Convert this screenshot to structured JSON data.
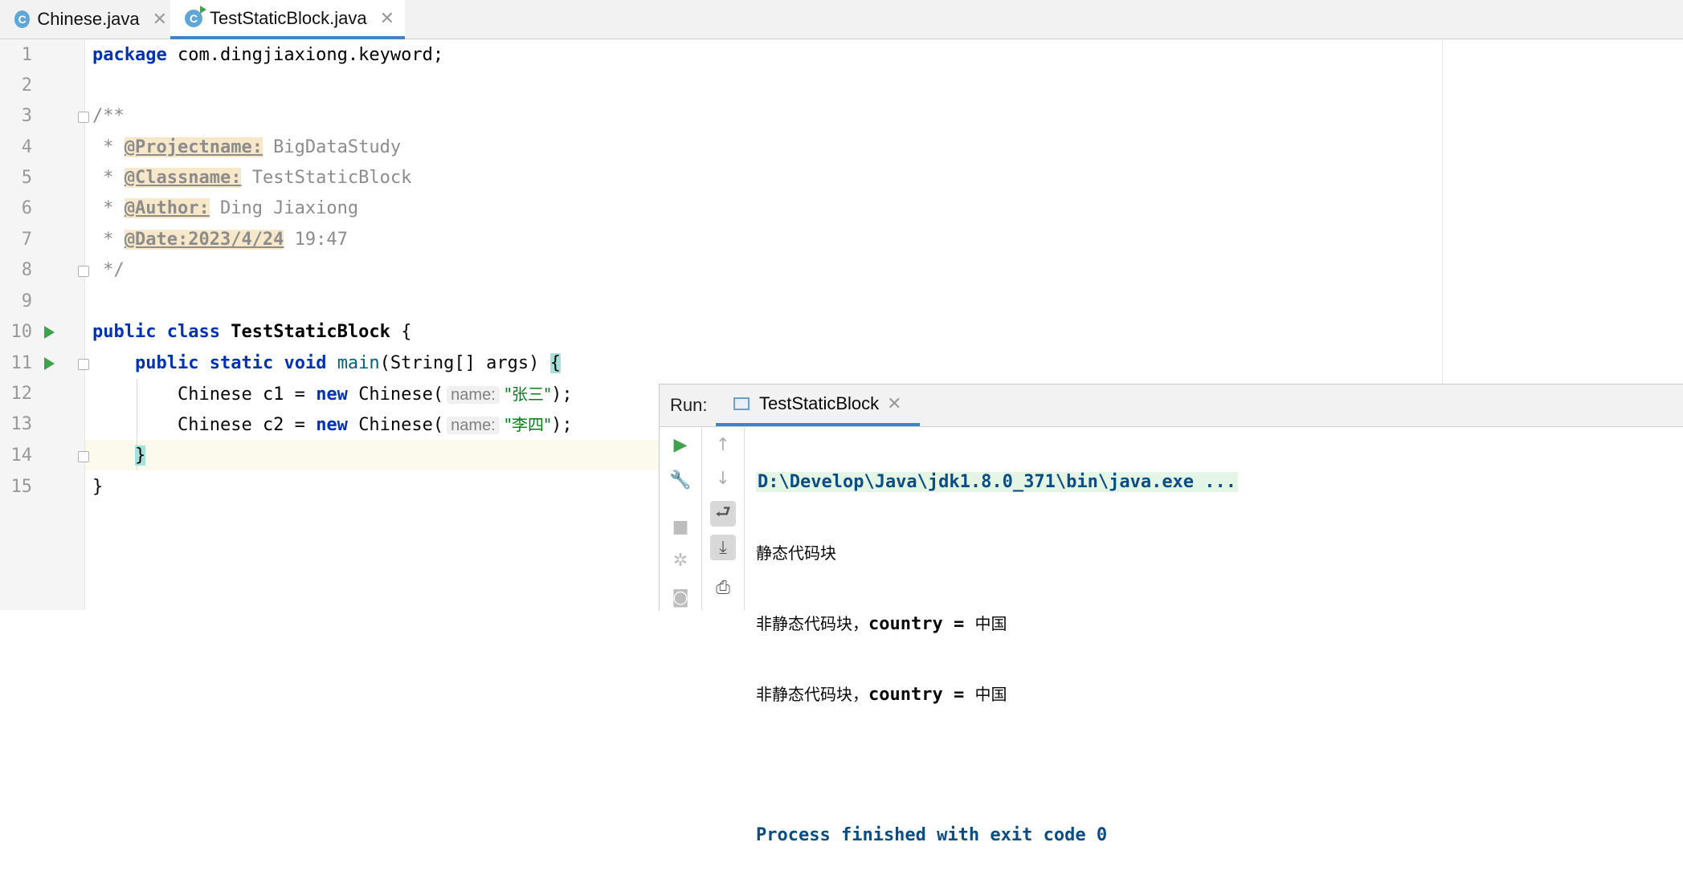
{
  "tabs": [
    {
      "label": "Chinese.java",
      "icon": "class-icon",
      "active": false
    },
    {
      "label": "TestStaticBlock.java",
      "icon": "runnable-class-icon",
      "active": true
    }
  ],
  "editor": {
    "line_numbers": [
      "1",
      "2",
      "3",
      "4",
      "5",
      "6",
      "7",
      "8",
      "9",
      "10",
      "11",
      "12",
      "13",
      "14",
      "15"
    ],
    "package_kw": "package",
    "package_name": " com.dingjiaxiong.keyword;",
    "doc_open": "/**",
    "doc_star": " * ",
    "tag_project": "@Projectname:",
    "val_project": " BigDataStudy",
    "tag_class": "@Classname:",
    "val_class": " TestStaticBlock",
    "tag_author": "@Author:",
    "val_author": " Ding Jiaxiong",
    "tag_date": "@Date:2023/4/24",
    "val_date": " 19:47",
    "doc_close": " */",
    "kw_public": "public",
    "kw_class": "class",
    "class_name": "TestStaticBlock",
    "open_brace": "{",
    "kw_static": "static",
    "kw_void": "void",
    "main_name": "main",
    "main_params": "(String[] args) ",
    "type_chinese": "Chinese",
    "var_c1": "c1",
    "var_c2": "c2",
    "eq": " = ",
    "kw_new": "new",
    "ctor": "Chinese(",
    "hint_name": "name:",
    "str_1": "\"张三\"",
    "str_2": "\"李四\"",
    "stmt_end": ");",
    "close_brace": "}"
  },
  "run_panel": {
    "label": "Run:",
    "tab_label": "TestStaticBlock",
    "console": [
      "D:\\Develop\\Java\\jdk1.8.0_371\\bin\\java.exe ...",
      "静态代码块",
      "非静态代码块，",
      "非静态代码块，",
      "",
      "Process finished with exit code 0"
    ],
    "country_label": "country",
    "country_eq": " = ",
    "country_val": "中国"
  }
}
